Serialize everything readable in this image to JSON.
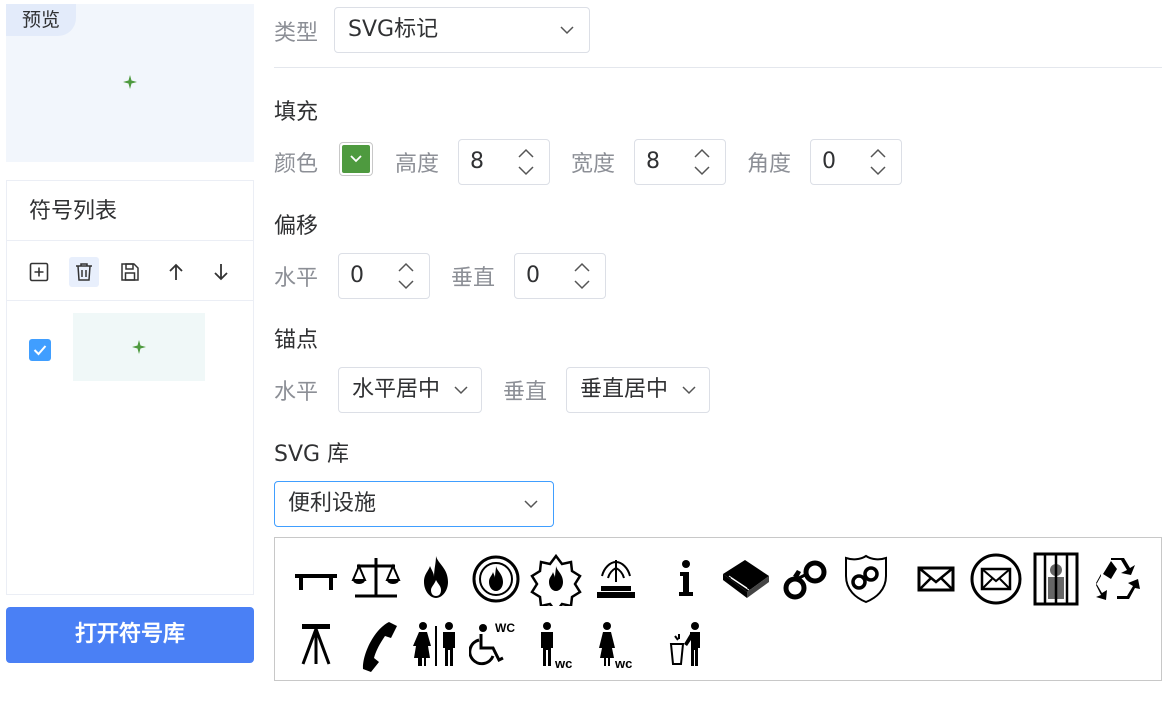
{
  "preview": {
    "tab_label": "预览"
  },
  "symbol_list": {
    "title": "符号列表",
    "tools": [
      "add-icon",
      "trash-icon",
      "save-icon",
      "arrow-up-icon",
      "arrow-down-icon"
    ],
    "items": [
      {
        "checked": true,
        "mark_color": "#4e9a3f"
      }
    ]
  },
  "open_library_button": "打开符号库",
  "type": {
    "label": "类型",
    "value": "SVG标记"
  },
  "fill": {
    "section": "填充",
    "color_label": "颜色",
    "color": "#4e9a3f",
    "height_label": "高度",
    "height": "8",
    "width_label": "宽度",
    "width": "8",
    "angle_label": "角度",
    "angle": "0"
  },
  "offset": {
    "section": "偏移",
    "horizontal_label": "水平",
    "horizontal": "0",
    "vertical_label": "垂直",
    "vertical": "0"
  },
  "anchor": {
    "section": "锚点",
    "horizontal_label": "水平",
    "horizontal": "水平居中",
    "vertical_label": "垂直",
    "vertical": "垂直居中"
  },
  "svg_library": {
    "section": "SVG 库",
    "category": "便利设施",
    "icons": [
      "table-icon",
      "scales-icon",
      "fire-icon",
      "fire-department-icon",
      "fire-department-alt-icon",
      "fountain-icon",
      "info-icon",
      "book-icon",
      "handcuffs-icon",
      "police-badge-icon",
      "mail-icon",
      "mail-circle-icon",
      "prison-icon",
      "recycle-icon",
      "tripod-icon",
      "telephone-icon",
      "restroom-icon",
      "accessible-wc-icon",
      "men-wc-icon",
      "women-wc-icon",
      "litter-bin-icon"
    ]
  }
}
